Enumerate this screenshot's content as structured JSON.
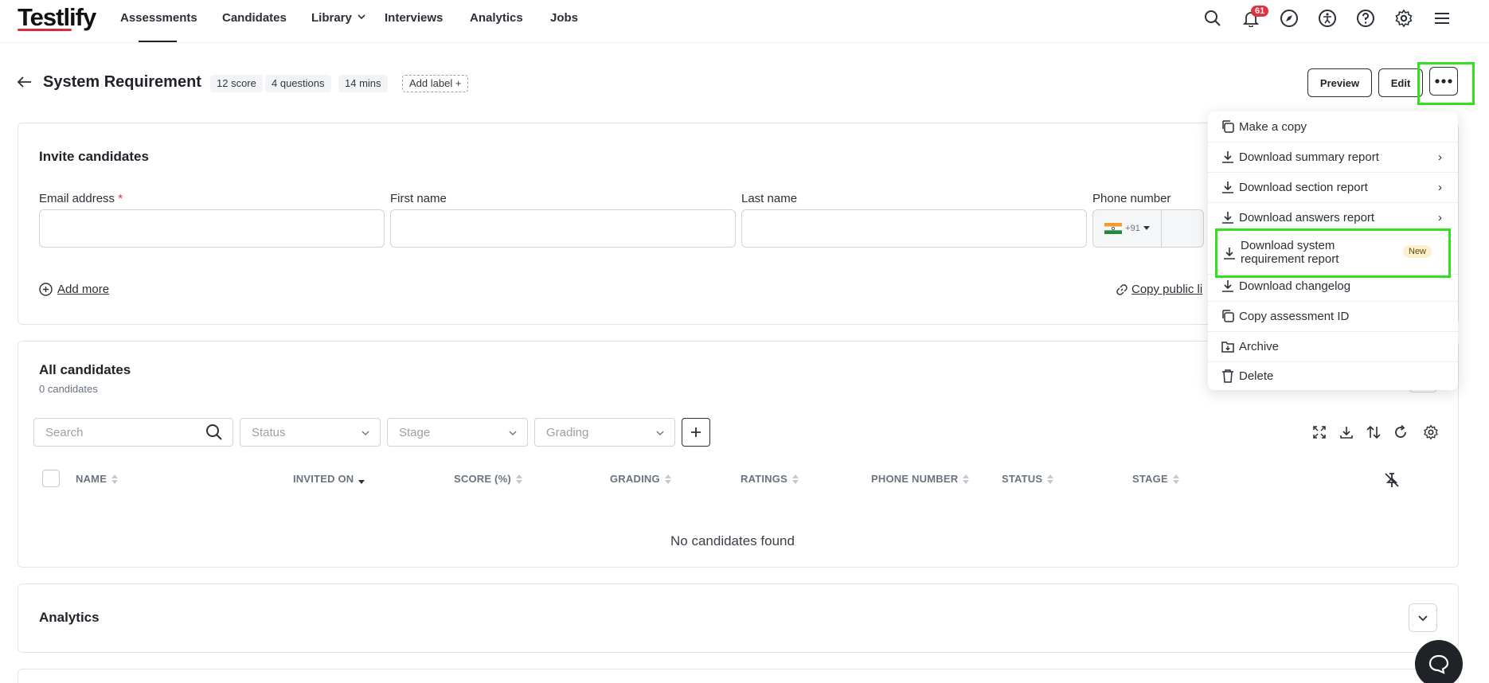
{
  "nav": {
    "logo": "Testlify",
    "items": [
      "Assessments",
      "Candidates",
      "Library",
      "Interviews",
      "Analytics",
      "Jobs"
    ],
    "notification_count": "61",
    "icons": [
      "search-icon",
      "bell-icon",
      "compass-icon",
      "accessibility-icon",
      "help-icon",
      "gear-icon",
      "menu-icon"
    ]
  },
  "header": {
    "title": "System Requirement",
    "chips": [
      "12 score",
      "4 questions",
      "14 mins"
    ],
    "add_label": "Add label +",
    "preview_label": "Preview",
    "edit_label": "Edit"
  },
  "invite": {
    "title": "Invite candidates",
    "email_label": "Email address",
    "required_mark": "*",
    "first_name_label": "First name",
    "last_name_label": "Last name",
    "phone_label": "Phone number",
    "phone_code": "+91",
    "add_more": "Add more",
    "copy_public_link": "Copy public li"
  },
  "candidates": {
    "title": "All candidates",
    "count": "0 candidates",
    "search_placeholder": "Search",
    "filters": [
      "Status",
      "Stage",
      "Grading"
    ],
    "columns": [
      "NAME",
      "INVITED ON",
      "SCORE (%)",
      "GRADING",
      "RATINGS",
      "PHONE NUMBER",
      "STATUS",
      "STAGE"
    ],
    "empty": "No candidates found"
  },
  "analytics": {
    "title": "Analytics"
  },
  "menu": {
    "items": [
      {
        "label": "Make a copy",
        "icon": "copy-icon",
        "arrow": ""
      },
      {
        "label": "Download summary report",
        "icon": "download-icon",
        "arrow": "›"
      },
      {
        "label": "Download section report",
        "icon": "download-icon",
        "arrow": "›"
      },
      {
        "label": "Download answers report",
        "icon": "download-icon",
        "arrow": "›"
      },
      {
        "label_line1": "Download system",
        "label_line2": "requirement report",
        "icon": "download-icon",
        "badge": "New"
      },
      {
        "label": "Download changelog",
        "icon": "download-icon",
        "arrow": ""
      },
      {
        "label": "Copy assessment ID",
        "icon": "copy-icon",
        "arrow": ""
      },
      {
        "label": "Archive",
        "icon": "archive-icon",
        "arrow": ""
      },
      {
        "label": "Delete",
        "icon": "trash-icon",
        "arrow": ""
      }
    ]
  },
  "colors": {
    "highlight": "#32e11e",
    "badge_red": "#e0323e",
    "new_badge_bg": "#fcf1cc"
  }
}
